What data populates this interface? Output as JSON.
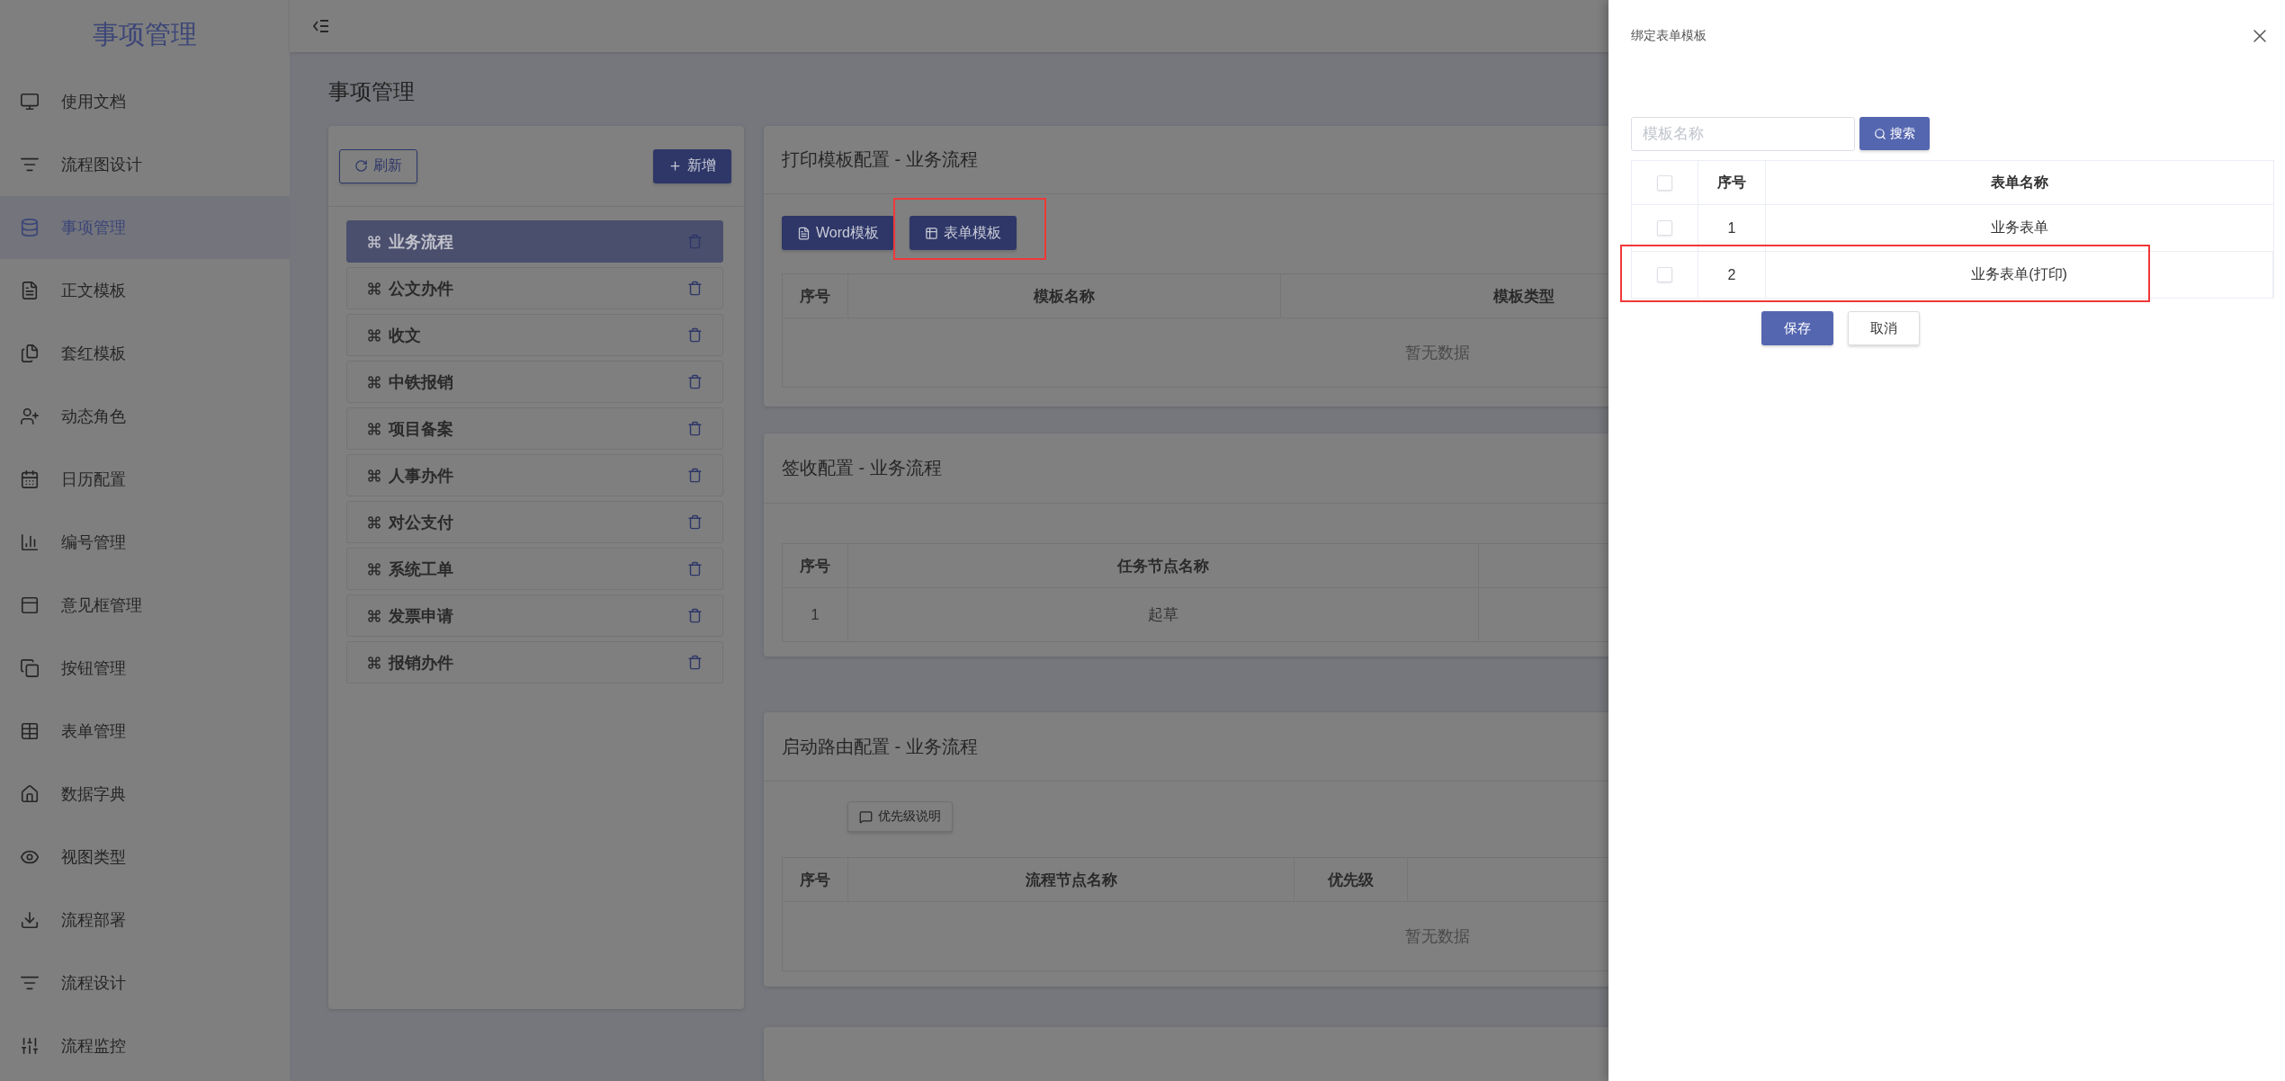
{
  "sidebar": {
    "title": "事项管理",
    "items": [
      {
        "label": "使用文档",
        "selected": false
      },
      {
        "label": "流程图设计",
        "selected": false
      },
      {
        "label": "事项管理",
        "selected": true
      },
      {
        "label": "正文模板",
        "selected": false
      },
      {
        "label": "套红模板",
        "selected": false
      },
      {
        "label": "动态角色",
        "selected": false
      },
      {
        "label": "日历配置",
        "selected": false
      },
      {
        "label": "编号管理",
        "selected": false
      },
      {
        "label": "意见框管理",
        "selected": false
      },
      {
        "label": "按钮管理",
        "selected": false
      },
      {
        "label": "表单管理",
        "selected": false
      },
      {
        "label": "数据字典",
        "selected": false
      },
      {
        "label": "视图类型",
        "selected": false
      },
      {
        "label": "流程部署",
        "selected": false
      },
      {
        "label": "流程设计",
        "selected": false
      },
      {
        "label": "流程监控",
        "selected": false
      }
    ]
  },
  "page": {
    "title": "事项管理"
  },
  "process_panel": {
    "buttons": [
      {
        "label": "刷新",
        "kind": "outline"
      },
      {
        "label": "新增",
        "kind": "primary"
      }
    ],
    "items": [
      {
        "label": "业务流程",
        "selected": true
      },
      {
        "label": "公文办件",
        "selected": false
      },
      {
        "label": "收文",
        "selected": false
      },
      {
        "label": "中铁报销",
        "selected": false
      },
      {
        "label": "项目备案",
        "selected": false
      },
      {
        "label": "人事办件",
        "selected": false
      },
      {
        "label": "对公支付",
        "selected": false
      },
      {
        "label": "系统工单",
        "selected": false
      },
      {
        "label": "发票申请",
        "selected": false
      },
      {
        "label": "报销办件",
        "selected": false
      }
    ]
  },
  "sections": [
    {
      "title": "打印模板配置 - 业务流程",
      "buttons": [
        {
          "label": "Word模板",
          "kind": "word",
          "highlighted": false
        },
        {
          "label": "表单模板",
          "kind": "form",
          "highlighted": true
        }
      ],
      "table": {
        "columns": [
          "序号",
          "模板名称",
          "模板类型"
        ],
        "empty_text": "暂无数据"
      }
    },
    {
      "title": "签收配置 - 业务流程",
      "table": {
        "columns": [
          "序号",
          "任务节点名称"
        ],
        "rows": [
          [
            "1",
            "起草"
          ]
        ]
      }
    },
    {
      "title": "启动路由配置 - 业务流程",
      "buttons": [
        {
          "label": "优先级说明",
          "kind": "help",
          "highlighted": false
        }
      ],
      "table": {
        "columns": [
          "序号",
          "流程节点名称",
          "优先级"
        ],
        "empty_text": "暂无数据"
      }
    }
  ],
  "drawer": {
    "title": "绑定表单模板",
    "search": {
      "placeholder": "模板名称",
      "button": "搜索"
    },
    "table": {
      "header_checked": false,
      "columns": [
        "序号",
        "表单名称"
      ],
      "rows": [
        {
          "cells": [
            "1",
            "业务表单"
          ],
          "checked": false,
          "highlighted": false
        },
        {
          "cells": [
            "2",
            "业务表单(打印)"
          ],
          "checked": false,
          "highlighted": true
        }
      ]
    },
    "buttons": [
      {
        "label": "保存",
        "kind": "primary"
      },
      {
        "label": "取消",
        "kind": "default"
      }
    ]
  }
}
